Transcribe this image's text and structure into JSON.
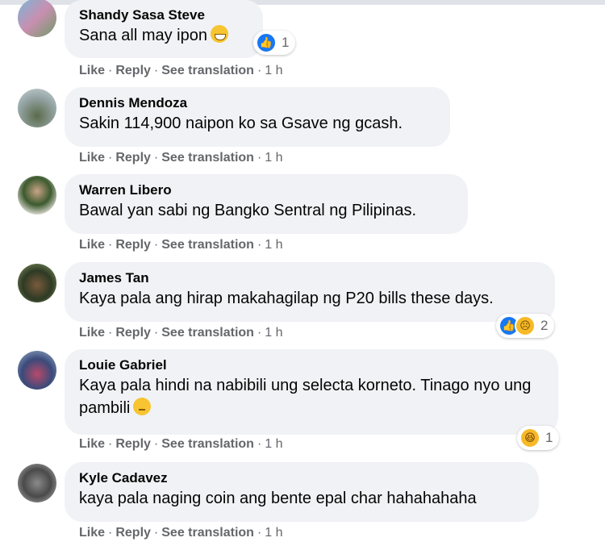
{
  "ui": {
    "like": "Like",
    "reply": "Reply",
    "see_translation": "See translation",
    "sep": "·",
    "time": "1 h"
  },
  "colors": {
    "bubble": "#f0f2f5",
    "meta": "#65676b",
    "like_blue": "#1877f2",
    "emoji_yellow": "#f7b928"
  },
  "comments": [
    {
      "name": "Shandy Sasa Steve",
      "text": "Sana all may ipon",
      "emoji": "grinning-sweat-emoji",
      "reactions": [
        "like"
      ],
      "count": "1"
    },
    {
      "name": "Dennis Mendoza",
      "text": "Sakin 114,900 naipon ko sa Gsave ng gcash."
    },
    {
      "name": "Warren Libero",
      "text": "Bawal yan sabi ng Bangko Sentral ng Pilipinas."
    },
    {
      "name": "James Tan",
      "text": "Kaya pala ang hirap makahagilap ng P20 bills these days.",
      "reactions": [
        "like",
        "sad"
      ],
      "count": "2"
    },
    {
      "name": "Louie Gabriel",
      "text": "Kaya pala hindi na nabibili ung selecta korneto. Tinago nyo ung pambili",
      "emoji": "eye-roll-emoji",
      "reactions": [
        "haha"
      ],
      "count": "1"
    },
    {
      "name": "Kyle Cadavez",
      "text": "kaya pala naging coin ang bente epal char hahahahaha"
    }
  ]
}
